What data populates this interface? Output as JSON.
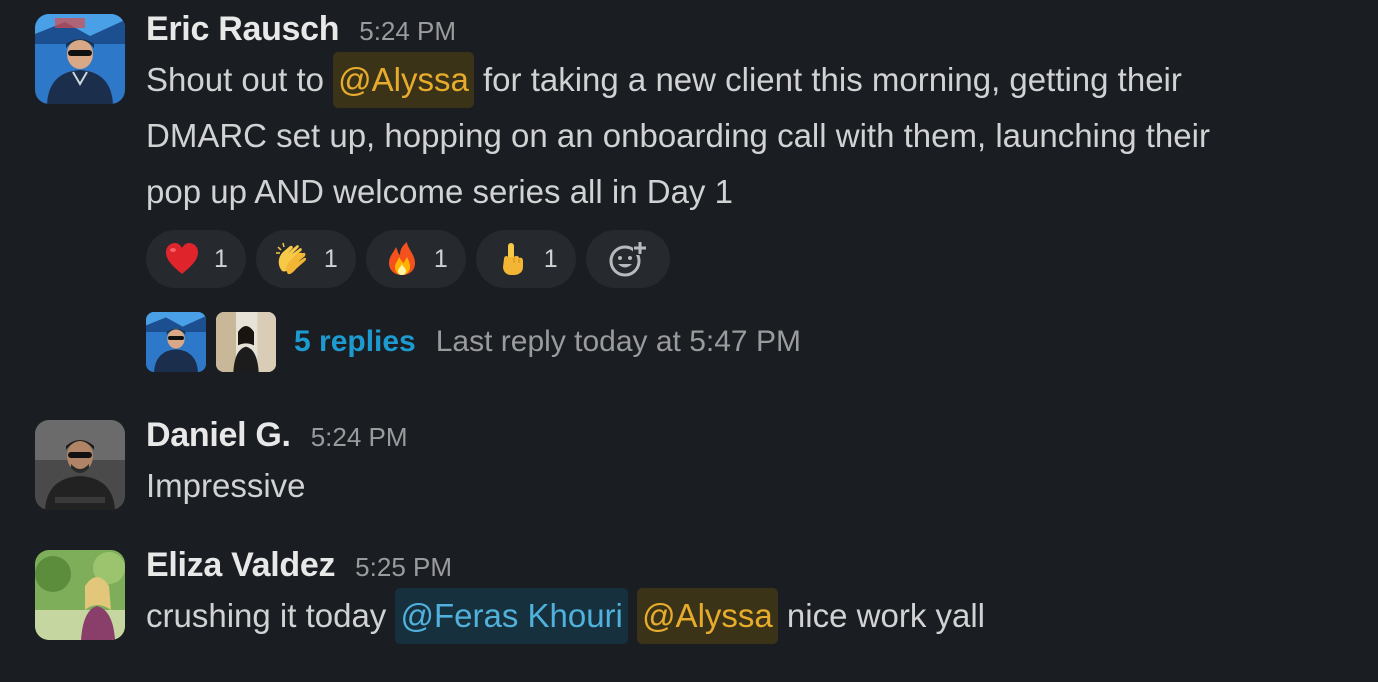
{
  "messages": [
    {
      "author": "Eric Rausch",
      "time": "5:24 PM",
      "text_before": "Shout out to ",
      "mention": "@Alyssa",
      "text_line1_after": " for taking a new client this morning, getting their",
      "text_line2": "DMARC set up, hopping on an onboarding call with them, launching their",
      "text_line3": "pop up AND welcome series all in Day 1",
      "reactions": [
        {
          "emoji": "heart-emoji",
          "count": "1"
        },
        {
          "emoji": "clapping-hands-emoji",
          "count": "1"
        },
        {
          "emoji": "fire-emoji",
          "count": "1"
        },
        {
          "emoji": "pointing-up-emoji",
          "count": "1"
        }
      ],
      "add_reaction_icon": "add-reaction-icon",
      "thread": {
        "replies": "5 replies",
        "last_reply": "Last reply today at 5:47 PM"
      }
    },
    {
      "author": "Daniel G.",
      "time": "5:24 PM",
      "text": "Impressive"
    },
    {
      "author": "Eliza Valdez",
      "time": "5:25 PM",
      "text_before": "crushing it today ",
      "mention_1": "@Feras Khouri",
      "mention_2": "@Alyssa",
      "text_after": " nice work yall"
    }
  ],
  "colors": {
    "background": "#1a1d21",
    "mention_self_bg": "#3b3318",
    "mention_self_fg": "#e8ac2d",
    "mention_other_bg": "#16303d",
    "mention_other_fg": "#4fb1dc",
    "link": "#1d9bd1"
  }
}
